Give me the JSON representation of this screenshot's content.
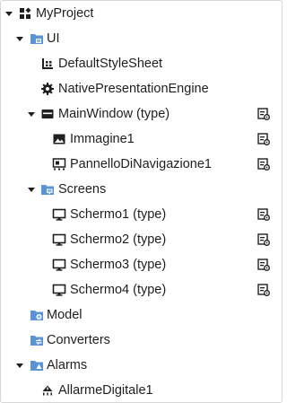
{
  "tree": {
    "root": {
      "label": "MyProject",
      "icon": "project-grid-icon"
    },
    "ui": {
      "label": "UI",
      "icon": "folder-ui-icon"
    },
    "default_style_sheet": {
      "label": "DefaultStyleSheet",
      "icon": "style-sheet-icon"
    },
    "native_presentation_engine": {
      "label": "NativePresentationEngine",
      "icon": "gear-icon"
    },
    "main_window": {
      "label": "MainWindow (type)",
      "icon": "window-icon",
      "badge_icon": "type-edit-icon"
    },
    "immagine1": {
      "label": "Immagine1",
      "icon": "image-icon",
      "badge_icon": "type-edit-icon"
    },
    "pannello": {
      "label": "PannelloDiNavigazione1",
      "icon": "navigation-panel-icon",
      "badge_icon": "type-edit-icon"
    },
    "screens": {
      "label": "Screens",
      "icon": "folder-screens-icon"
    },
    "schermo1": {
      "label": "Schermo1 (type)",
      "icon": "monitor-icon",
      "badge_icon": "type-edit-icon"
    },
    "schermo2": {
      "label": "Schermo2 (type)",
      "icon": "monitor-icon",
      "badge_icon": "type-edit-icon"
    },
    "schermo3": {
      "label": "Schermo3 (type)",
      "icon": "monitor-icon",
      "badge_icon": "type-edit-icon"
    },
    "schermo4": {
      "label": "Schermo4 (type)",
      "icon": "monitor-icon",
      "badge_icon": "type-edit-icon"
    },
    "model": {
      "label": "Model",
      "icon": "folder-model-icon"
    },
    "converters": {
      "label": "Converters",
      "icon": "folder-converters-icon"
    },
    "alarms": {
      "label": "Alarms",
      "icon": "folder-alarms-icon"
    },
    "allarme_digitale1": {
      "label": "AllarmeDigitale1",
      "icon": "alarm-icon"
    }
  },
  "colors": {
    "text": "#1e1e1e",
    "icon_dark": "#1f1f1f",
    "folder_blue": "#5b93d3",
    "folder_blue_light": "#8fb8e6",
    "border": "#d6d6d6"
  }
}
